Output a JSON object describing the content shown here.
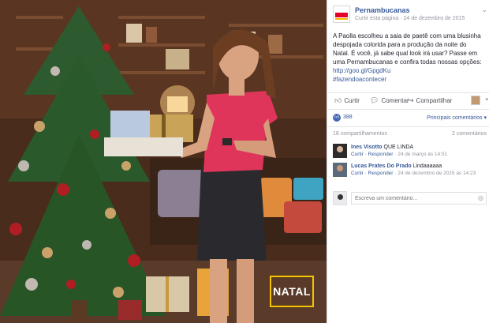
{
  "badge": {
    "label": "NATAL"
  },
  "post": {
    "page_name": "Pernambucanas",
    "follow_link": "Curtir esta página",
    "date": "24 de dezembro de 2015",
    "text_main": "A Paolla escolheu a saia de paetê com uma blusinha despojada colorida para a produção da noite do Natal. É você, já sabe qual look irá usar? Passe em uma Pernambucanas e confira todas nossas opções:",
    "url": "http://goo.gl/GpgdKu",
    "hashtag": "#fazendoacontecer"
  },
  "actions": {
    "like": "Curtir",
    "comment": "Comentar",
    "share": "Compartilhar"
  },
  "reactions": {
    "count": "388",
    "top_comments": "Principais comentários"
  },
  "counts": {
    "shares": "18 compartilhamentos",
    "comments": "2 comentários"
  },
  "comments": [
    {
      "name": "Ines Visotto",
      "text": "QUE LINDA",
      "reply": "Curtir · Responder",
      "date": "24 de março às 14:51"
    },
    {
      "name": "Lucas Prates Do Prado",
      "text": "Lindaaaaaa",
      "reply": "Curtir · Responder",
      "date": "24 de dezembro de 2015 às 14:23"
    }
  ],
  "write_comment": {
    "placeholder": "Escreva um comentário..."
  },
  "colors": {
    "brand_red": "#e4002b",
    "link_blue": "#365899",
    "badge_yellow": "#f5c400"
  }
}
